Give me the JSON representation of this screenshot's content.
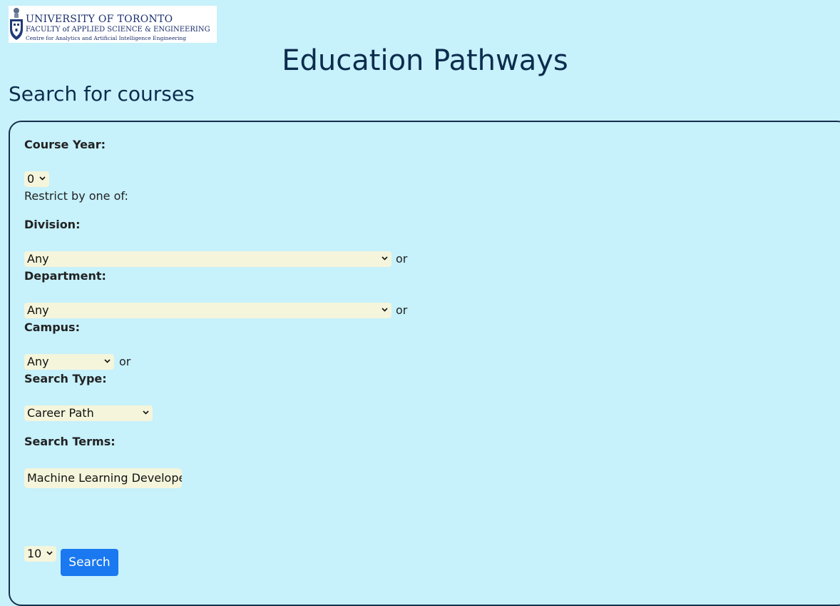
{
  "logo": {
    "line1": "UNIVERSITY OF TORONTO",
    "line2": "FACULTY of APPLIED SCIENCE & ENGINEERING",
    "line3": "Centre for Analytics and Artificial Intelligence Engineering"
  },
  "header": {
    "title": "Education Pathways",
    "section_title": "Search for courses"
  },
  "form": {
    "course_year": {
      "label": "Course Year:",
      "value": "0"
    },
    "restrict_text": "Restrict by one of:",
    "division": {
      "label": "Division:",
      "value": "Any",
      "suffix": "or"
    },
    "department": {
      "label": "Department:",
      "value": "Any",
      "suffix": "or"
    },
    "campus": {
      "label": "Campus:",
      "value": "Any",
      "suffix": "or"
    },
    "search_type": {
      "label": "Search Type:",
      "value": "Career Path"
    },
    "search_terms": {
      "label": "Search Terms:",
      "value": "Machine Learning Develope"
    },
    "results_count": {
      "value": "10"
    },
    "search_button": "Search"
  },
  "colors": {
    "background": "#c7f1fb",
    "heading": "#0c2c4d",
    "field": "#f5f5dc",
    "button": "#1a78f0"
  }
}
